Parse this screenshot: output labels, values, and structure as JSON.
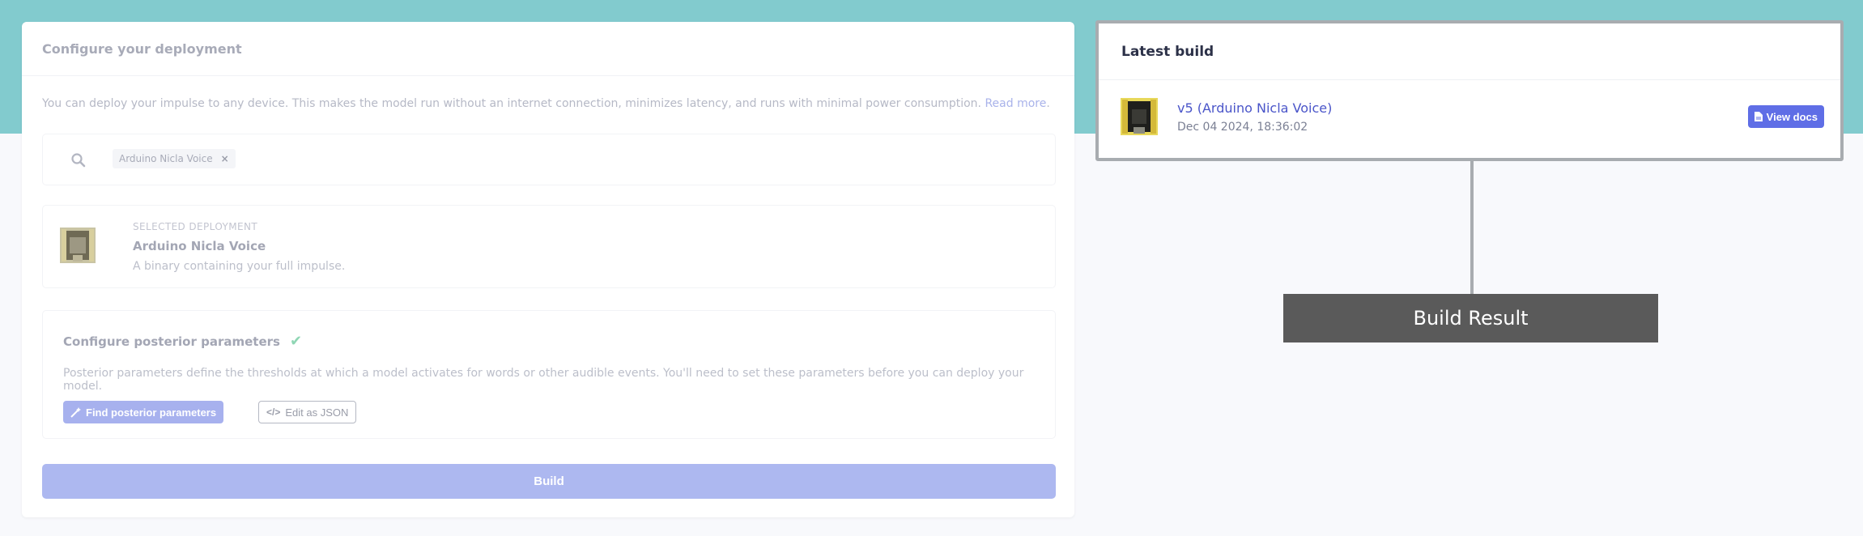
{
  "configure": {
    "title": "Configure your deployment",
    "intro": "You can deploy your impulse to any device. This makes the model run without an internet connection, minimizes latency, and runs with minimal power consumption.",
    "read_more": "Read more",
    "period": ".",
    "search_chip": "Arduino Nicla Voice",
    "chip_close": "×"
  },
  "selected": {
    "label": "SELECTED DEPLOYMENT",
    "name": "Arduino Nicla Voice",
    "description": "A binary containing your full impulse."
  },
  "posterior": {
    "title": "Configure posterior parameters",
    "description": "Posterior parameters define the thresholds at which a model activates for words or other audible events. You'll need to set these parameters before you can deploy your model.",
    "find_button": "Find posterior parameters",
    "json_button": "Edit as JSON"
  },
  "build_button": "Build",
  "latest_build": {
    "title": "Latest build",
    "version": "v5 (Arduino Nicla Voice)",
    "date": "Dec 04 2024, 18:36:02",
    "docs_button": "View docs"
  },
  "annotation": "Build Result",
  "colors": {
    "teal": "#82cbce",
    "primary": "#5f6ee6",
    "highlight_border": "#a8acb0"
  },
  "icons": [
    "search-icon",
    "close-icon",
    "check-icon",
    "wand-icon",
    "code-icon",
    "document-icon",
    "board-image"
  ]
}
